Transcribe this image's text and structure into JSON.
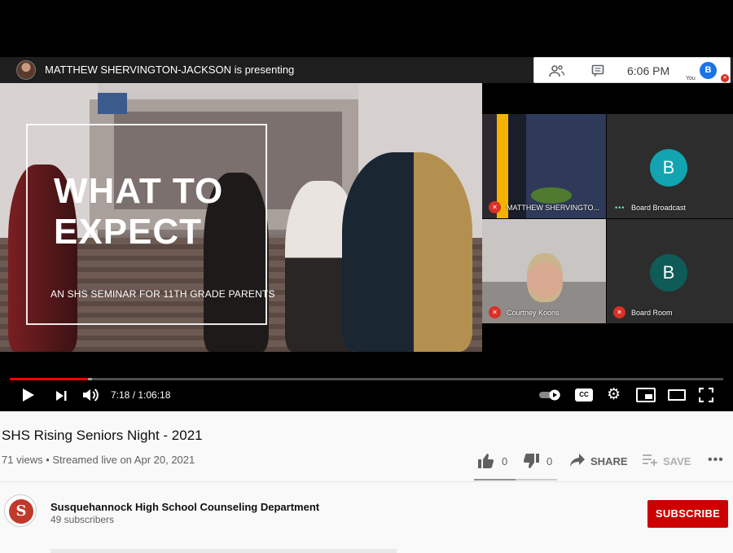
{
  "player": {
    "presenter_text": "MATTHEW SHERVINGTON-JACKSON is presenting",
    "toolbar": {
      "time": "6:06 PM",
      "you_label": "You",
      "avatar_letter": "B"
    },
    "slide": {
      "title_line1": "WHAT TO",
      "title_line2": "EXPECT",
      "subtitle": "AN SHS SEMINAR FOR 11TH GRADE PARENTS"
    },
    "tiles": [
      {
        "name": "MATTHEW SHERVINGTO..."
      },
      {
        "name": "Board Broadcast",
        "avatar_letter": "B"
      },
      {
        "name": "Courtney Koons"
      },
      {
        "name": "Board Room",
        "avatar_letter": "B"
      }
    ],
    "progress": {
      "played_fraction": 0.11,
      "buffered_fraction": 0.115
    },
    "time_display": "7:18 / 1:06:18",
    "cc_label": "CC"
  },
  "video": {
    "title": "SHS Rising Seniors Night - 2021",
    "meta": "71 views • Streamed live on Apr 20, 2021",
    "likes": "0",
    "dislikes": "0",
    "share_label": "SHARE",
    "save_label": "SAVE",
    "more_label": "•••",
    "like_fraction": 0.5
  },
  "channel": {
    "name": "Susquehannock High School Counseling Department",
    "subscribers": "49 subscribers",
    "subscribe_label": "SUBSCRIBE"
  },
  "colors": {
    "accent_red": "#cc0000",
    "progress_red": "#ff0000",
    "meet_blue": "#1a73e8"
  }
}
